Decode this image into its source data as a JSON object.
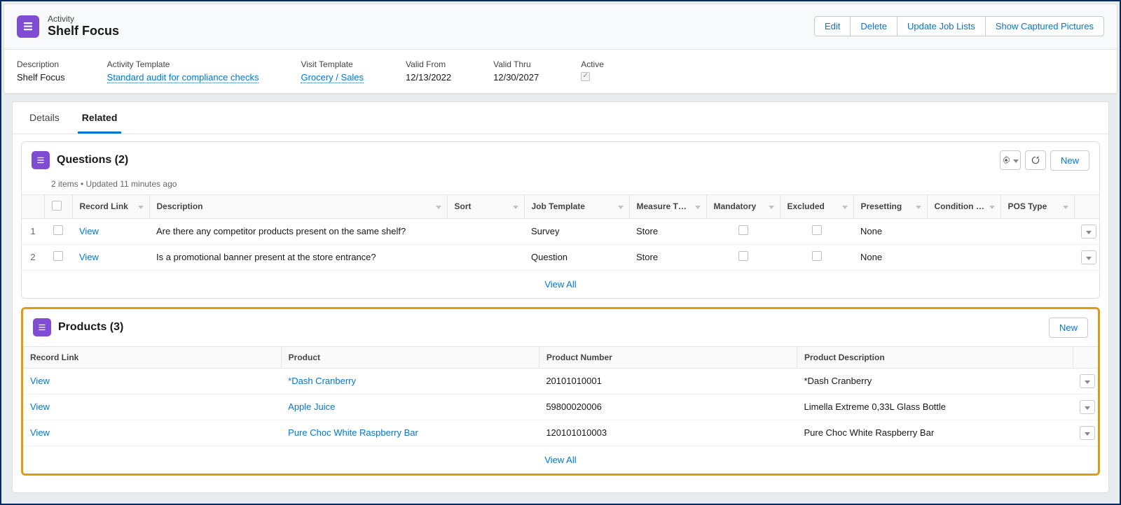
{
  "header": {
    "object_label": "Activity",
    "record_title": "Shelf Focus",
    "actions": {
      "edit": "Edit",
      "delete": "Delete",
      "update_job_lists": "Update Job Lists",
      "show_pictures": "Show Captured Pictures"
    }
  },
  "highlights": {
    "items": [
      {
        "label": "Description",
        "value": "Shelf Focus",
        "type": "text"
      },
      {
        "label": "Activity Template",
        "value": "Standard audit for compliance checks",
        "type": "link"
      },
      {
        "label": "Visit Template",
        "value": "Grocery / Sales",
        "type": "link"
      },
      {
        "label": "Valid From",
        "value": "12/13/2022",
        "type": "text"
      },
      {
        "label": "Valid Thru",
        "value": "12/30/2027",
        "type": "text"
      },
      {
        "label": "Active",
        "value": "checked",
        "type": "checkbox"
      }
    ]
  },
  "tabs": {
    "details": "Details",
    "related": "Related"
  },
  "questions": {
    "title": "Questions (2)",
    "meta": "2 items • Updated 11 minutes ago",
    "new_label": "New",
    "view_all": "View All",
    "columns": {
      "record_link": "Record Link",
      "description": "Description",
      "sort": "Sort",
      "job_template": "Job Template",
      "measure_type": "Measure T…",
      "mandatory": "Mandatory",
      "excluded": "Excluded",
      "presetting": "Presetting",
      "condition": "Condition …",
      "pos_type": "POS Type"
    },
    "rows": [
      {
        "idx": "1",
        "link": "View",
        "description": "Are there any competitor products present on the same shelf?",
        "sort": "",
        "job_template": "Survey",
        "measure_type": "Store",
        "mandatory": false,
        "excluded": false,
        "presetting": "None",
        "condition": "",
        "pos_type": ""
      },
      {
        "idx": "2",
        "link": "View",
        "description": "Is a promotional banner present at the store entrance?",
        "sort": "",
        "job_template": "Question",
        "measure_type": "Store",
        "mandatory": false,
        "excluded": false,
        "presetting": "None",
        "condition": "",
        "pos_type": ""
      }
    ]
  },
  "products": {
    "title": "Products (3)",
    "new_label": "New",
    "view_all": "View All",
    "columns": {
      "record_link": "Record Link",
      "product": "Product",
      "product_number": "Product Number",
      "product_description": "Product Description"
    },
    "rows": [
      {
        "link": "View",
        "product": "*Dash Cranberry",
        "number": "20101010001",
        "description": "*Dash Cranberry"
      },
      {
        "link": "View",
        "product": "Apple Juice",
        "number": "59800020006",
        "description": "Limella Extreme 0,33L Glass Bottle"
      },
      {
        "link": "View",
        "product": "Pure Choc White Raspberry Bar",
        "number": "120101010003",
        "description": "Pure Choc White Raspberry Bar"
      }
    ]
  }
}
